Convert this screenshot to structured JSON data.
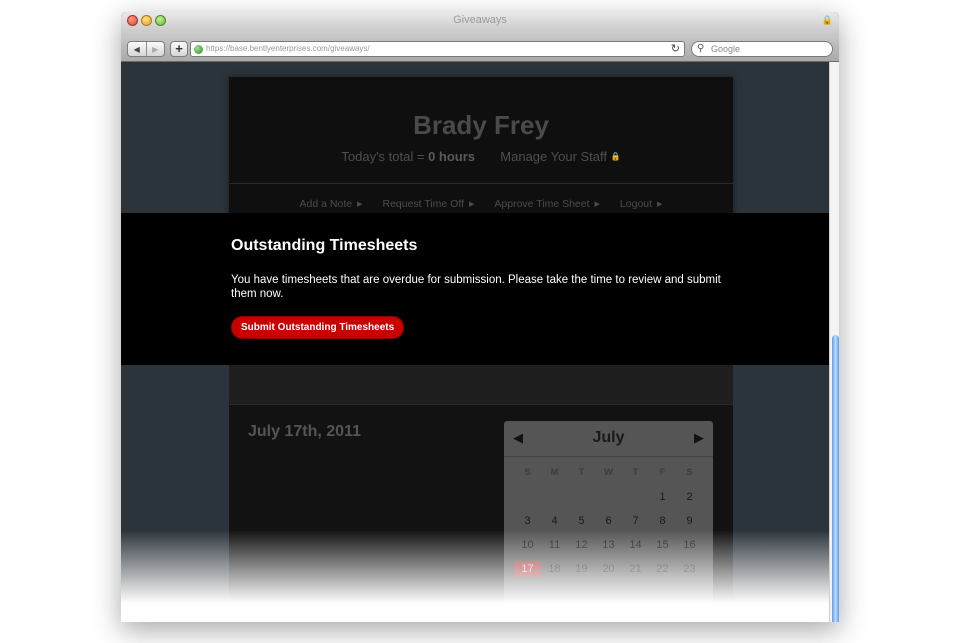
{
  "window": {
    "title": "Giveaways",
    "url": "https://base.bentlyenterprises.com/giveaways/",
    "search_placeholder": "Google"
  },
  "header": {
    "name": "Brady Frey",
    "today_prefix": "Today's total =",
    "today_value": "0 hours",
    "manage_link": "Manage Your Staff",
    "menu": [
      {
        "label": "Add a Note"
      },
      {
        "label": "Request Time Off"
      },
      {
        "label": "Approve Time Sheet"
      },
      {
        "label": "Logout"
      }
    ]
  },
  "banner": {
    "title": "Outstanding Timesheets",
    "message": "You have timesheets that are overdue for submission. Please take the time to review and submit them now.",
    "button": "Submit Outstanding Timesheets"
  },
  "content": {
    "date": "July 17th, 2011"
  },
  "calendar": {
    "month": "July",
    "weekdays": [
      "S",
      "M",
      "T",
      "W",
      "T",
      "F",
      "S"
    ],
    "weeks": [
      [
        "",
        "",
        "",
        "",
        "",
        "1",
        "2"
      ],
      [
        "3",
        "4",
        "5",
        "6",
        "7",
        "8",
        "9"
      ],
      [
        "10",
        "11",
        "12",
        "13",
        "14",
        "15",
        "16"
      ],
      [
        "17",
        "18",
        "19",
        "20",
        "21",
        "22",
        "23"
      ]
    ],
    "selected": "17"
  }
}
